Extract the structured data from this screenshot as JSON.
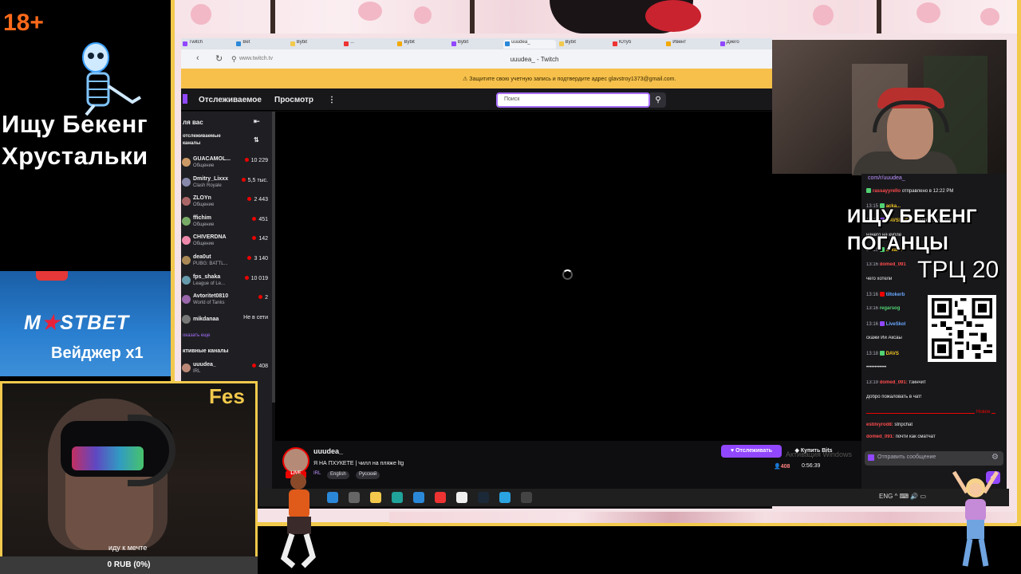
{
  "left_overlay": {
    "age_badge": "18+",
    "title_line1": "Ищу Бекенг",
    "title_line2": "Хрустальки",
    "sponsor_logo_left": "M",
    "sponsor_logo_star": "★",
    "sponsor_logo_right": "STBET",
    "sponsor_offer": "Вейджер x1"
  },
  "browser": {
    "tabs": [
      "Twitch",
      "Bet",
      "Bybit",
      "...",
      "Bybit",
      "Bybit",
      "uuudea_",
      "Bybit",
      "Ютуб",
      "Ивент",
      "Диего"
    ],
    "url": "www.twitch.tv",
    "page_title": "uuudea_ - Twitch",
    "warning_text": "⚠ Защитите свою учетную запись и подтвердите адрес glavstroy1373@gmail.com."
  },
  "twitch": {
    "nav": {
      "following": "Отслеживаемое",
      "browse": "Просмотр",
      "more": "⋮",
      "search_placeholder": "Поиск",
      "search_icon": "search-icon"
    },
    "sidebar": {
      "for_you": "ля вас",
      "collapse_icon": "⇤",
      "followed_header": "отслеживаемые каналы",
      "sort_icon": "⇅",
      "channels": [
        {
          "name": "GUACAMOL...",
          "category": "Общение",
          "viewers": "10 229",
          "color": "#c96"
        },
        {
          "name": "Dmitry_Lixxx",
          "category": "Clash Royale",
          "viewers": "5,5 тыс.",
          "color": "#88a"
        },
        {
          "name": "ZLOYn",
          "category": "Общение",
          "viewers": "2 443",
          "color": "#a66"
        },
        {
          "name": "ffichim",
          "category": "Общение",
          "viewers": "451",
          "color": "#7a6"
        },
        {
          "name": "CHIVERDNA",
          "category": "Общение",
          "viewers": "142",
          "color": "#e8a"
        },
        {
          "name": "dea0ut",
          "category": "PUBG: BATTL...",
          "viewers": "3 140",
          "color": "#a85"
        },
        {
          "name": "fps_shaka",
          "category": "League of Le...",
          "viewers": "10 019",
          "color": "#69a"
        },
        {
          "name": "Avtoritet0810",
          "category": "World of Tanks",
          "viewers": "2",
          "color": "#96a"
        },
        {
          "name": "mikdanaa",
          "category": "",
          "viewers": "Не в сети",
          "color": "#777"
        }
      ],
      "show_more": "оказать еще",
      "active_header": "ктивные каналы",
      "active_channel": {
        "name": "uuudea_",
        "category": "IRL",
        "viewers": "408",
        "color": "#b87"
      }
    },
    "stream_info": {
      "channel": "uuudea_",
      "title": "Я НА ПХУКЕТЕ | чилл на пляже ltg",
      "category": "IRL",
      "tags": [
        "English",
        "Русский"
      ],
      "live_badge": "LIVE",
      "follow_button": "♥ Отслеживать",
      "bits_button": "◆ Купить Bits",
      "viewers": "👤408",
      "uptime": "0:56:39",
      "windows_watermark": "Активация Windows"
    },
    "chat": {
      "link": "com/r/uuudea_",
      "messages": [
        {
          "time": "",
          "badge": "#52d273",
          "name": "rassayyrello",
          "name_class": "nm-red",
          "text": "отправлено в 12:22 PM"
        },
        {
          "time": "13:15",
          "badge": "#52d273",
          "name": "acka...",
          "name_class": "nm-yel",
          "text": ""
        },
        {
          "time": "13:15",
          "badge": "#9147ff",
          "name": "DAVSLORD:",
          "name_class": "nm-yel",
          "text": "привет, мы у тебя"
        },
        {
          "time": "",
          "badge": "",
          "name": "",
          "name_class": "",
          "text": "начего на купле"
        },
        {
          "time": "13:15",
          "badge": "#52d273",
          "name": "ackano",
          "name_class": "nm-yel",
          "text": ""
        },
        {
          "time": "13:16",
          "badge": "",
          "name": "domed_091",
          "name_class": "nm-red",
          "text": ""
        },
        {
          "time": "",
          "badge": "",
          "name": "",
          "name_class": "",
          "text": "чего хотели"
        },
        {
          "time": "13:16",
          "badge": "#eb0400",
          "name": "tiltokerb",
          "name_class": "nm-blu",
          "text": ""
        },
        {
          "time": "13:16",
          "badge": "",
          "name": "regarsog",
          "name_class": "nm-grn",
          "text": ""
        },
        {
          "time": "13:16",
          "badge": "#9147ff",
          "name": "LiveSkol",
          "name_class": "nm-blu",
          "text": ""
        },
        {
          "time": "",
          "badge": "",
          "name": "",
          "name_class": "",
          "text": "скажи Ии Аксаы"
        },
        {
          "time": "13:18",
          "badge": "#52d273",
          "name": "DAVS",
          "name_class": "nm-yel",
          "text": ""
        },
        {
          "time": "",
          "badge": "",
          "name": "",
          "name_class": "",
          "text": "••••••••••••"
        },
        {
          "time": "13:19",
          "badge": "",
          "name": "domed_091:",
          "name_class": "nm-red",
          "text": "тзинчит"
        },
        {
          "time": "",
          "badge": "",
          "name": "",
          "name_class": "",
          "text": "Добро пожаловать в чат!"
        }
      ],
      "new_label": "Новое",
      "after_new": [
        {
          "time": "",
          "badge": "",
          "name": "estilvyrod8:",
          "name_class": "nm-red",
          "text": "stripchat"
        },
        {
          "time": "",
          "badge": "",
          "name": "domed_091:",
          "name_class": "nm-red",
          "text": "почти как сматчат"
        }
      ],
      "input_placeholder": "Отправить сообщение",
      "settings_icon": "⚙",
      "bits_icon": "◆"
    }
  },
  "overlay_right": {
    "headline_line1": "ИЩУ БЕКЕНГ",
    "headline_line2": "ПОГАНЦЫ",
    "trc": "ТРЦ 20"
  },
  "bottom_left_cam": {
    "label": "Fes",
    "dream_text": "иду к мечте",
    "donation": "0 RUB (0%)"
  },
  "taskbar": {
    "icons": [
      {
        "name": "start-icon",
        "color": "#2b88d8"
      },
      {
        "name": "taskview-icon",
        "color": "#666"
      },
      {
        "name": "explorer-icon",
        "color": "#f2c94c"
      },
      {
        "name": "edge-icon",
        "color": "#1fa39a"
      },
      {
        "name": "mail-icon",
        "color": "#2b88d8"
      },
      {
        "name": "yandex-icon",
        "color": "#e33"
      },
      {
        "name": "yandex-browser-icon",
        "color": "#f0f0f0"
      },
      {
        "name": "steam-icon",
        "color": "#1b2838"
      },
      {
        "name": "telegram-icon",
        "color": "#2aa3e0"
      },
      {
        "name": "obs-icon",
        "color": "#444"
      }
    ],
    "tray": "ENG  ^  ⌨  🔊  ▭"
  },
  "colors": {
    "frame": "#f2c94c",
    "twitch_purple": "#9147ff",
    "live_red": "#eb0400",
    "age_orange": "#ff6a1a"
  }
}
